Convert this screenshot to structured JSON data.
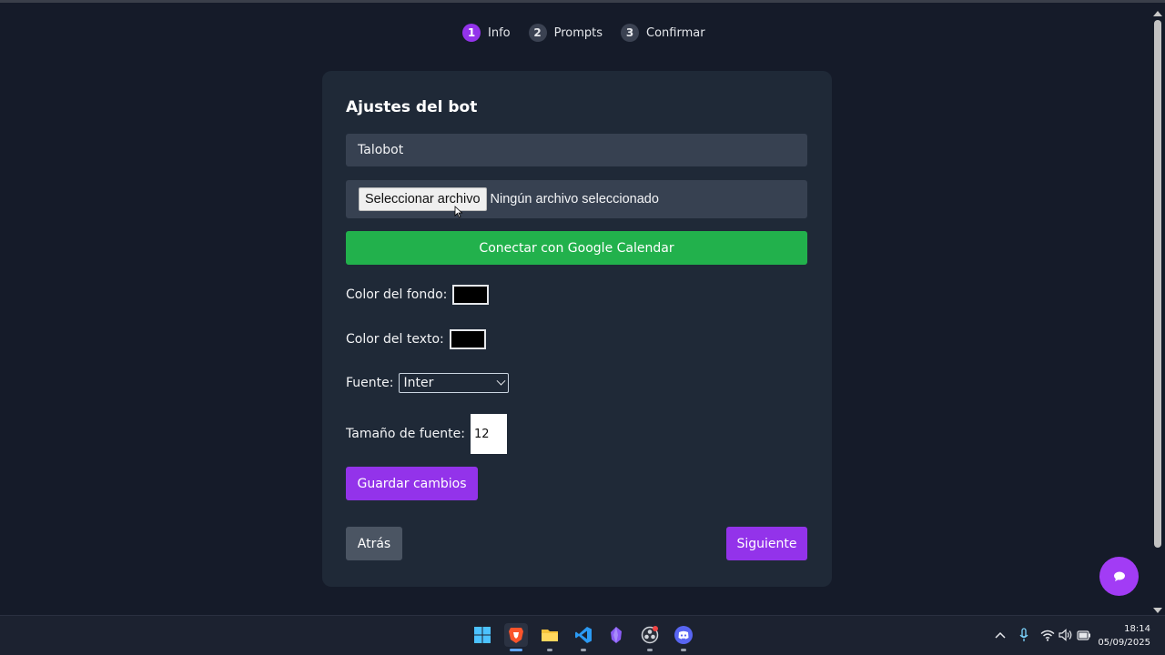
{
  "stepper": {
    "steps": [
      {
        "num": "1",
        "label": "Info"
      },
      {
        "num": "2",
        "label": "Prompts"
      },
      {
        "num": "3",
        "label": "Confirmar"
      }
    ]
  },
  "card": {
    "title": "Ajustes del bot",
    "bot_name_value": "Talobot",
    "file_button_label": "Seleccionar archivo",
    "file_status": "Ningún archivo seleccionado",
    "gcal_button_label": "Conectar con Google Calendar",
    "bg_color_label": "Color del fondo:",
    "bg_color_value": "#000000",
    "text_color_label": "Color del texto:",
    "text_color_value": "#000000",
    "font_label": "Fuente:",
    "font_value": "Inter",
    "font_size_label": "Tamaño de fuente:",
    "font_size_value": "12",
    "save_button_label": "Guardar cambios",
    "back_button_label": "Atrás",
    "next_button_label": "Siguiente"
  },
  "colors": {
    "accent": "#9333ea",
    "success": "#22b14c",
    "card_bg": "#1f2937",
    "page_bg": "#151b29"
  },
  "taskbar": {
    "apps": [
      "windows-start-icon",
      "brave-browser-icon",
      "file-explorer-icon",
      "vscode-icon",
      "obsidian-icon",
      "obs-studio-icon",
      "discord-icon"
    ],
    "time": "18:14",
    "date": "05/09/2025"
  }
}
